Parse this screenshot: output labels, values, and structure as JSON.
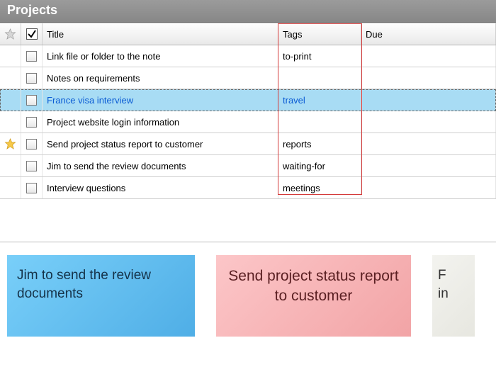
{
  "window": {
    "title": "Projects"
  },
  "columns": {
    "title": "Title",
    "tags": "Tags",
    "due": "Due"
  },
  "rows": [
    {
      "starred": false,
      "title": "Link file or folder to the note",
      "tags": "to-print",
      "due": "",
      "selected": false
    },
    {
      "starred": false,
      "title": "Notes on requirements",
      "tags": "",
      "due": "",
      "selected": false
    },
    {
      "starred": false,
      "title": "France visa interview",
      "tags": "travel",
      "due": "",
      "selected": true
    },
    {
      "starred": false,
      "title": "Project website login information",
      "tags": "",
      "due": "",
      "selected": false
    },
    {
      "starred": true,
      "title": "Send project status report to customer",
      "tags": "reports",
      "due": "",
      "selected": false
    },
    {
      "starred": false,
      "title": "Jim to send the review documents",
      "tags": "waiting-for",
      "due": "",
      "selected": false
    },
    {
      "starred": false,
      "title": "Interview questions",
      "tags": "meetings",
      "due": "",
      "selected": false
    }
  ],
  "stickies": {
    "blue": "Jim to send the review documents",
    "pink": "Send project status report to customer",
    "grey_partial": "F\nin"
  }
}
